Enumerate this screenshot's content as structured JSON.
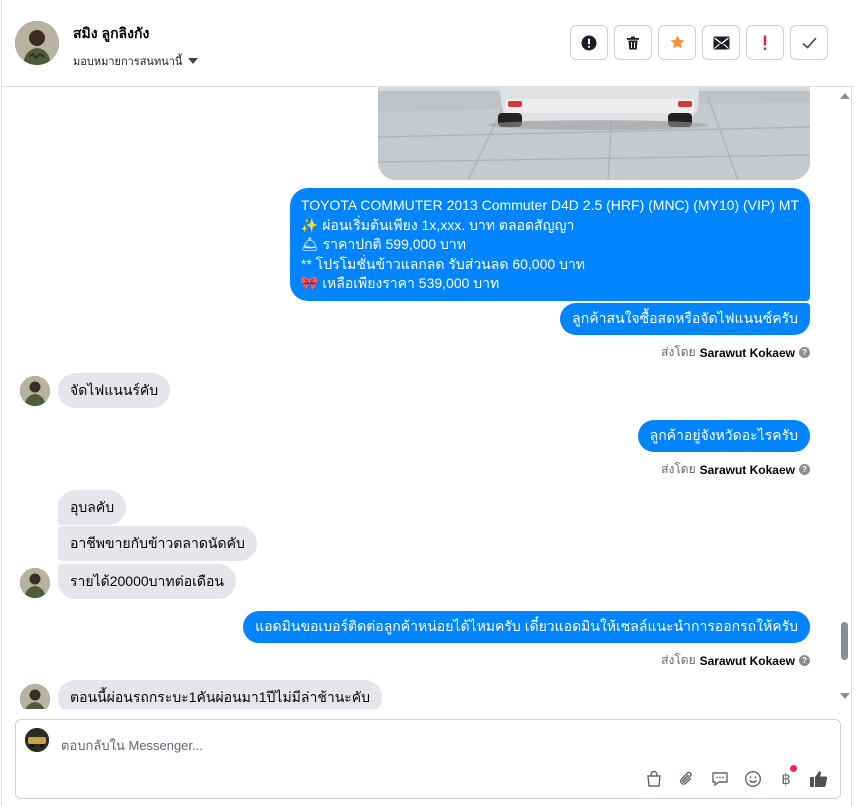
{
  "header": {
    "contact_name": "สมิง ลูกลิงกัง",
    "assign_label": "มอบหมายการสนทนานี้"
  },
  "actions": [
    {
      "name": "report-spam",
      "icon": "alert-circle-icon"
    },
    {
      "name": "delete",
      "icon": "trash-icon"
    },
    {
      "name": "star",
      "icon": "star-icon",
      "color": "#f7923b"
    },
    {
      "name": "mark-unread",
      "icon": "envelope-icon"
    },
    {
      "name": "follow-up",
      "icon": "exclamation-icon",
      "color": "#e41e3f"
    },
    {
      "name": "mark-done",
      "icon": "check-icon"
    }
  ],
  "messages": {
    "offer": [
      "TOYOTA COMMUTER 2013 Commuter D4D 2.5 (HRF) (MNC) (MY10) (VIP) MT",
      "✨  ผ่อนเริ่มต้นเพียง 1x,xxx. บาท ตลอดสัญญา",
      "🛎 ราคาปกติ 599,000 บาท",
      "** โปรโมชั่นข้าวแลกลด รับส่วนลด 60,000 บาท",
      "🎀  เหลือเพียงราคา 539,000 บาท"
    ],
    "out_1": "ลูกค้าสนใจซื้อสดหรือจัดไฟแนนซ์ครับ",
    "in_1": "จัดไฟแนนร์คับ",
    "out_2": "ลูกค้าอยู่จังหวัดอะไรครับ",
    "in_2": "อุบลคับ",
    "in_3": "อาชีพขายกับข้าวตลาดนัดคับ",
    "in_4": "รายได้20000บาทต่อเดือน",
    "out_3": "แอดมินขอเบอร์ติดต่อลูกค้าหน่อยได้ไหมครับ เดี๋ยวแอดมินให้เซลล์แนะนำการออกรถให้ครับ",
    "in_5": "ตอนนี้ผ่อนรถกระบะ1คันผ่อนมา1ปีไม่มีล่าช้านะคับ"
  },
  "sent_by": {
    "prefix": "ส่งโดย",
    "agent": "Sarawut Kokaew"
  },
  "composer": {
    "placeholder": "ตอบกลับใน Messenger..."
  },
  "colors": {
    "outgoing_bubble": "#0084ff",
    "incoming_bubble": "#e4e6eb",
    "notification_dot": "#f02849"
  }
}
